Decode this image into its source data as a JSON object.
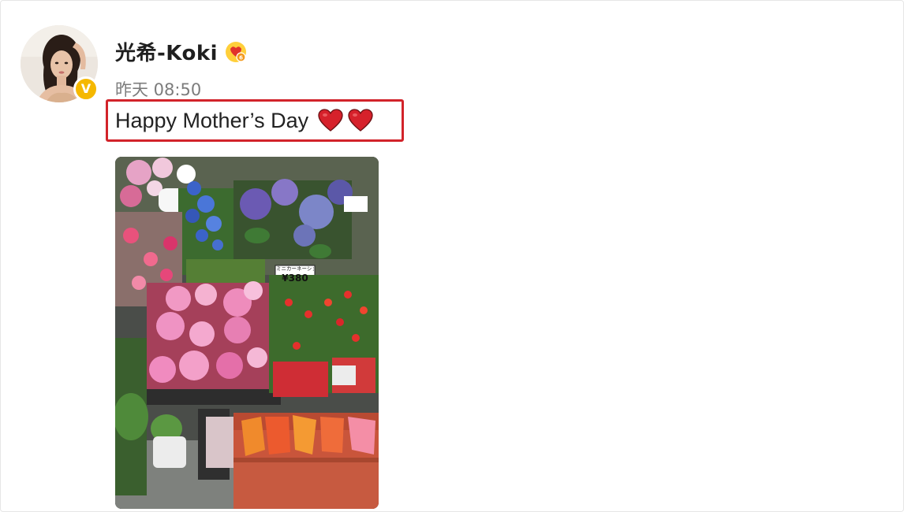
{
  "post": {
    "author": "光希-Koki",
    "timestamp": "昨天 08:50",
    "text": "Happy Mother’s Day",
    "text_emojis": [
      "red-heart",
      "red-heart"
    ],
    "badge_icon": "verified-v-badge",
    "badge_letter": "V",
    "vip_icon": "vip-member-icon"
  },
  "image": {
    "description_icon": "flower-shop-photo",
    "price_tag_label": "ミニカーネーション",
    "price_tag_value": "¥380"
  },
  "colors": {
    "highlight_border": "#d2232a",
    "badge": "#f5b800",
    "heart": "#d6212b"
  }
}
